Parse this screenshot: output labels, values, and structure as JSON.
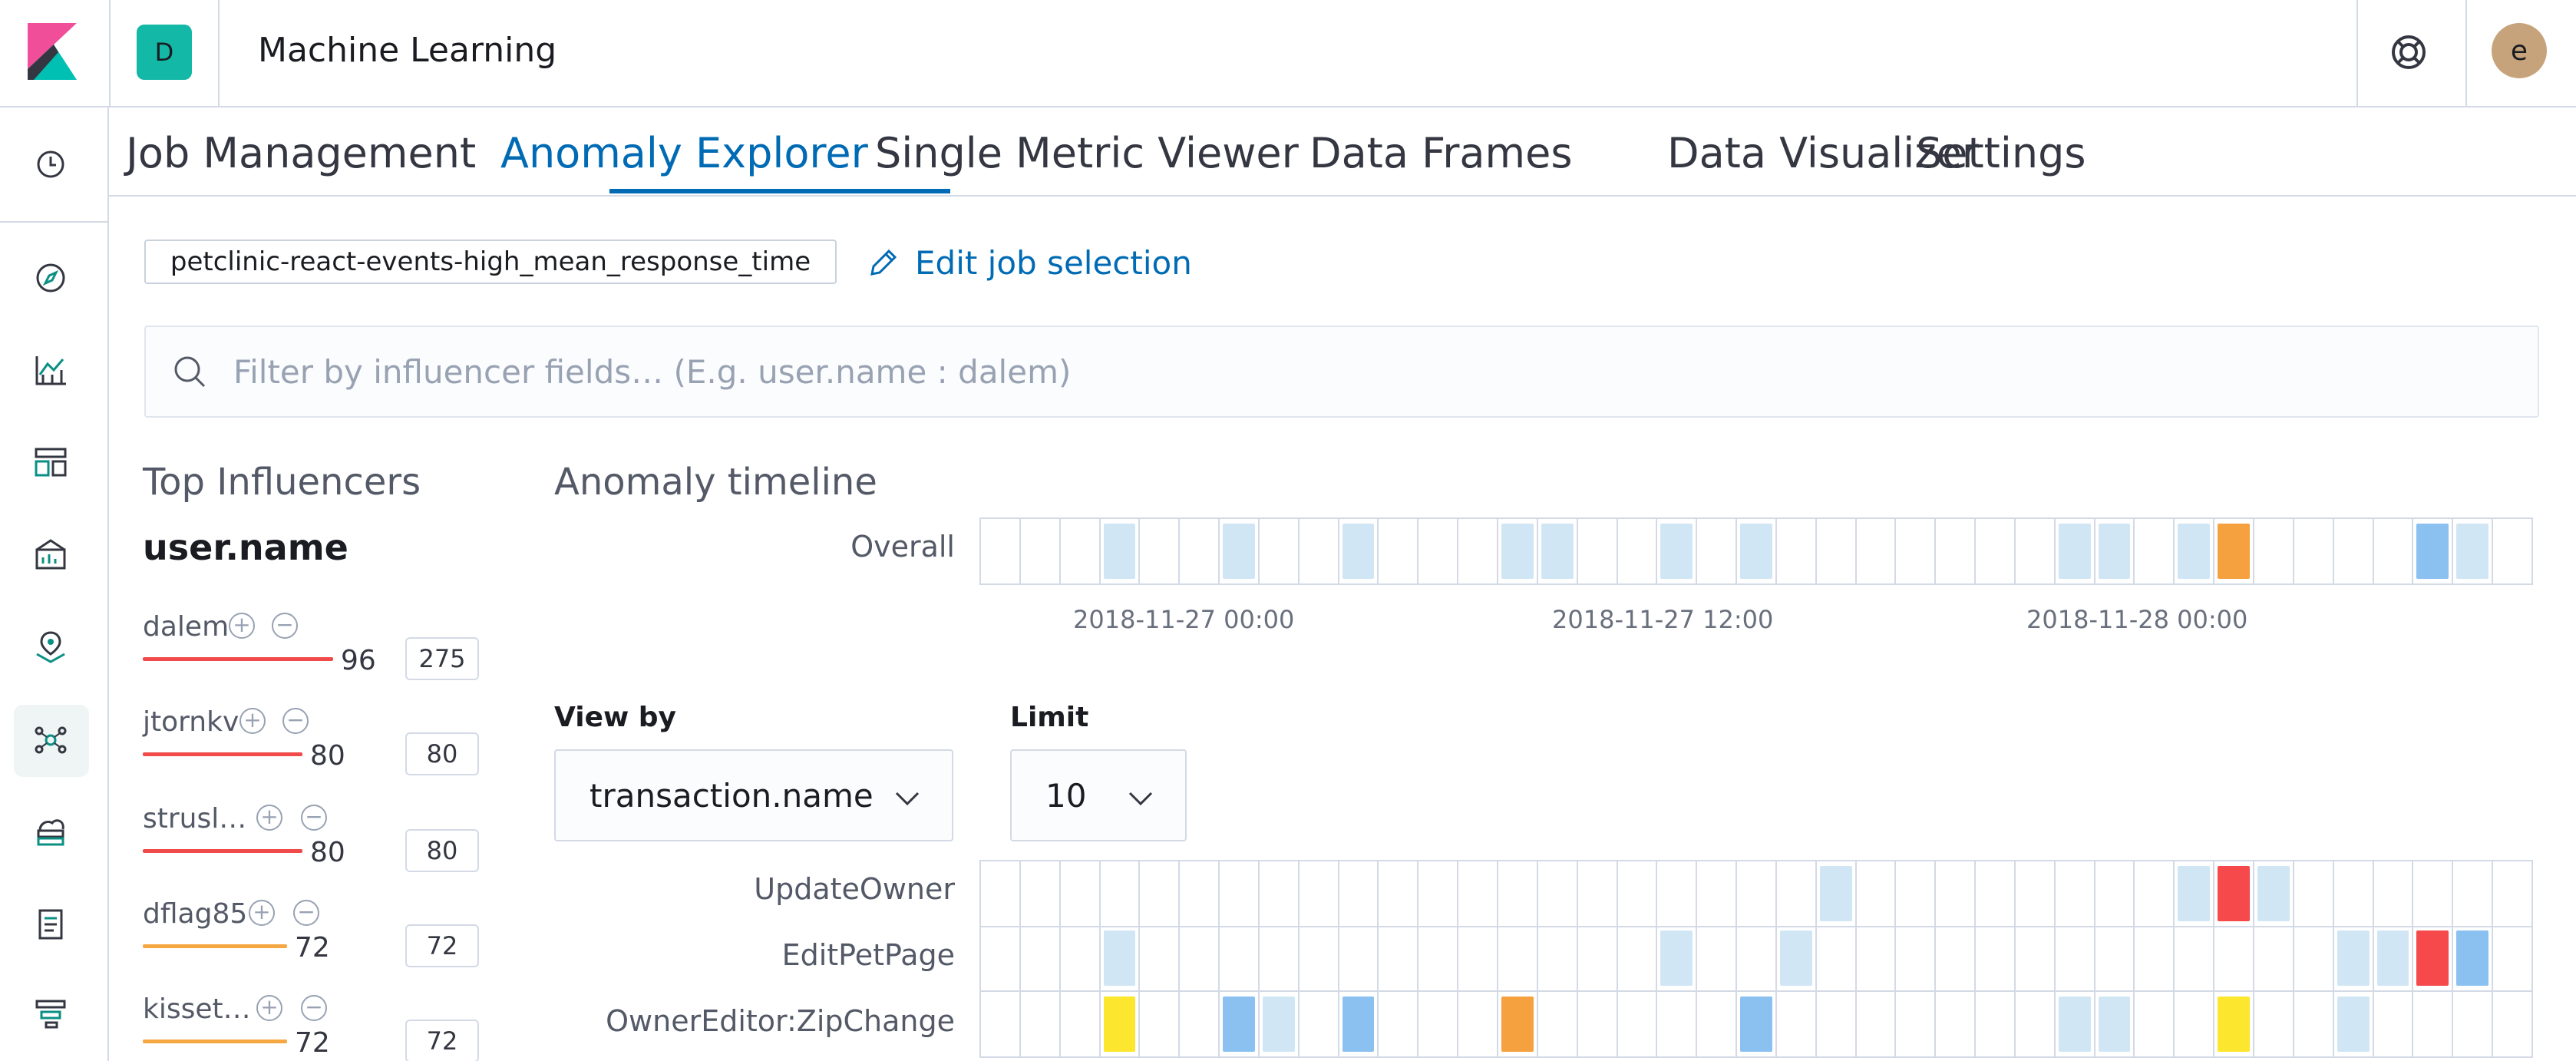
{
  "header": {
    "space_initial": "D",
    "app_title": "Machine Learning",
    "user_initial": "e"
  },
  "sidebar": {
    "icons": [
      "clock-icon",
      "compass-icon",
      "visualize-icon",
      "dashboard-icon",
      "canvas-icon",
      "maps-icon",
      "machine-learning-icon",
      "infrastructure-icon",
      "logs-icon",
      "apm-icon"
    ],
    "active": "machine-learning-icon"
  },
  "tabs": [
    "Job Management",
    "Anomaly Explorer",
    "Single Metric Viewer",
    "Data Frames",
    "Data Visualizer",
    "Settings"
  ],
  "active_tab": "Anomaly Explorer",
  "job": {
    "id": "petclinic-react-events-high_mean_response_time",
    "edit_label": "Edit job selection"
  },
  "filter": {
    "placeholder": "Filter by influencer fields… (E.g. user.name : dalem)"
  },
  "influencers": {
    "title": "Top Influencers",
    "field": "user.name",
    "items": [
      {
        "name": "dalem",
        "score": "96",
        "count": "275",
        "color": "#f04a4a"
      },
      {
        "name": "jtornkv",
        "score": "80",
        "count": "80",
        "color": "#f04a4a"
      },
      {
        "name": "strusl…",
        "score": "80",
        "count": "80",
        "color": "#f04a4a"
      },
      {
        "name": "dflag85",
        "score": "72",
        "count": "72",
        "color": "#f5a742"
      },
      {
        "name": "kisset…",
        "score": "72",
        "count": "72",
        "color": "#f5a742"
      }
    ]
  },
  "timeline": {
    "title": "Anomaly timeline",
    "overall_label": "Overall",
    "time_labels": [
      "2018-11-27 00:00",
      "2018-11-27 12:00",
      "2018-11-28 00:00"
    ],
    "view_by_label": "View by",
    "view_by_value": "transaction.name",
    "limit_label": "Limit",
    "limit_value": "10",
    "colors": {
      "low": "#d1e6f5",
      "mid": "#8bc1f0",
      "warning": "#fde62e",
      "minor": "#f5a13f",
      "critical": "#f5494b"
    },
    "rows": [
      {
        "name": "Overall",
        "cells": {
          "3": "low",
          "6": "low",
          "9": "low",
          "13": "low",
          "14": "low",
          "17": "low",
          "19": "low",
          "27": "low",
          "28": "low",
          "30": "low",
          "31": "minor",
          "36": "mid",
          "37": "low"
        }
      },
      {
        "name": "UpdateOwner",
        "cells": {
          "21": "low",
          "30": "low",
          "31": "critical",
          "32": "low"
        }
      },
      {
        "name": "EditPetPage",
        "cells": {
          "3": "low",
          "17": "low",
          "20": "low",
          "34": "low",
          "35": "low",
          "36": "critical",
          "37": "mid"
        }
      },
      {
        "name": "OwnerEditor:ZipChange",
        "cells": {
          "3": "warning",
          "6": "mid",
          "7": "low",
          "9": "mid",
          "13": "minor",
          "19": "mid",
          "27": "low",
          "28": "low",
          "31": "warning",
          "34": "low"
        }
      }
    ]
  }
}
